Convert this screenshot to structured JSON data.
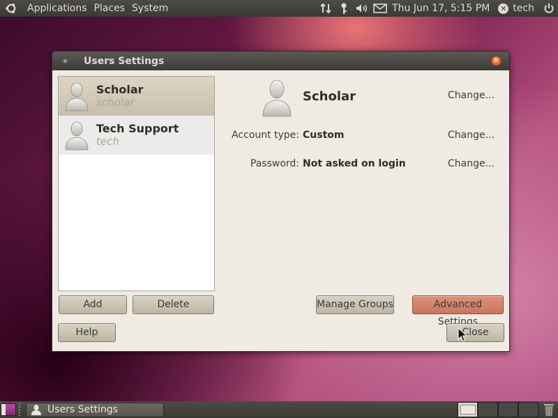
{
  "top_panel": {
    "menus": [
      "Applications",
      "Places",
      "System"
    ],
    "clock": "Thu Jun 17,  5:15 PM",
    "username": "tech"
  },
  "window": {
    "title": "Users Settings",
    "users": [
      {
        "name": "Scholar",
        "login": "scholar"
      },
      {
        "name": "Tech Support",
        "login": "tech"
      }
    ],
    "detail": {
      "name": "Scholar",
      "account_type_label": "Account type:",
      "account_type_value": "Custom",
      "password_label": "Password:",
      "password_value": "Not asked on login",
      "change_label": "Change..."
    },
    "buttons": {
      "add": "Add",
      "delete": "Delete",
      "manage_groups": "Manage Groups",
      "advanced_settings": "Advanced Settings",
      "help": "Help",
      "close": "Close"
    }
  },
  "bottom_panel": {
    "task_label": "Users Settings"
  },
  "colors": {
    "panel": "#3c3b37",
    "window_bg": "#f0ebe2",
    "selected_row": "#d0c7b6",
    "hover_button": "#d48a72"
  }
}
